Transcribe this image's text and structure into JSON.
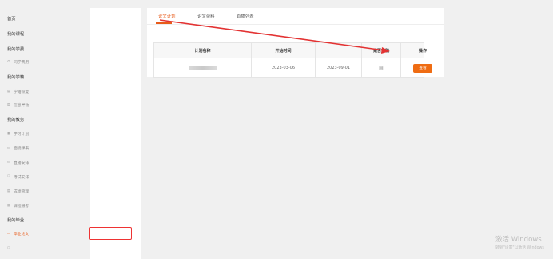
{
  "sidebar": {
    "items": [
      {
        "label": "首页",
        "type": "section",
        "icon": ""
      },
      {
        "label": "我的课程",
        "type": "section",
        "icon": ""
      },
      {
        "label": "我的学费",
        "type": "section",
        "icon": ""
      },
      {
        "label": "同学费用",
        "type": "sub",
        "icon": "circle-icon"
      },
      {
        "label": "我的学籍",
        "type": "section",
        "icon": ""
      },
      {
        "label": "学籍恢复",
        "type": "sub",
        "icon": "doc-icon"
      },
      {
        "label": "信息异动",
        "type": "sub",
        "icon": "doc-icon"
      },
      {
        "label": "我的教务",
        "type": "section",
        "icon": ""
      },
      {
        "label": "学习计划",
        "type": "sub",
        "icon": "grid-icon"
      },
      {
        "label": "面授课表",
        "type": "sub",
        "icon": "calendar-icon"
      },
      {
        "label": "直播安排",
        "type": "sub",
        "icon": "calendar-icon"
      },
      {
        "label": "考试安排",
        "type": "sub",
        "icon": "edit-icon"
      },
      {
        "label": "成绩管理",
        "type": "sub",
        "icon": "doc-icon"
      },
      {
        "label": "课程报考",
        "type": "sub",
        "icon": "doc-icon"
      },
      {
        "label": "我的毕业",
        "type": "section",
        "icon": ""
      },
      {
        "label": "毕业论文",
        "type": "sub",
        "icon": "calendar-icon",
        "active": true
      },
      {
        "label": "",
        "type": "sub",
        "icon": "edit-icon"
      }
    ]
  },
  "tabs": [
    {
      "label": "论文计划",
      "active": true
    },
    {
      "label": "论文资料",
      "active": false
    },
    {
      "label": "直播列表",
      "active": false
    }
  ],
  "table": {
    "headers": [
      "计划名称",
      "开始时间",
      "",
      "是否定稿",
      "操作"
    ],
    "rows": [
      {
        "name": "",
        "start": "2023-03-06",
        "end": "2023-09-01",
        "finalized_icon": "document-icon",
        "action": "查看"
      }
    ]
  },
  "watermark": {
    "title": "激活 Windows",
    "subtitle": "转到\"设置\"以激活 Windows"
  },
  "colors": {
    "accent": "#e85b1a",
    "button": "#ef6c13",
    "annotation": "#e33333"
  }
}
